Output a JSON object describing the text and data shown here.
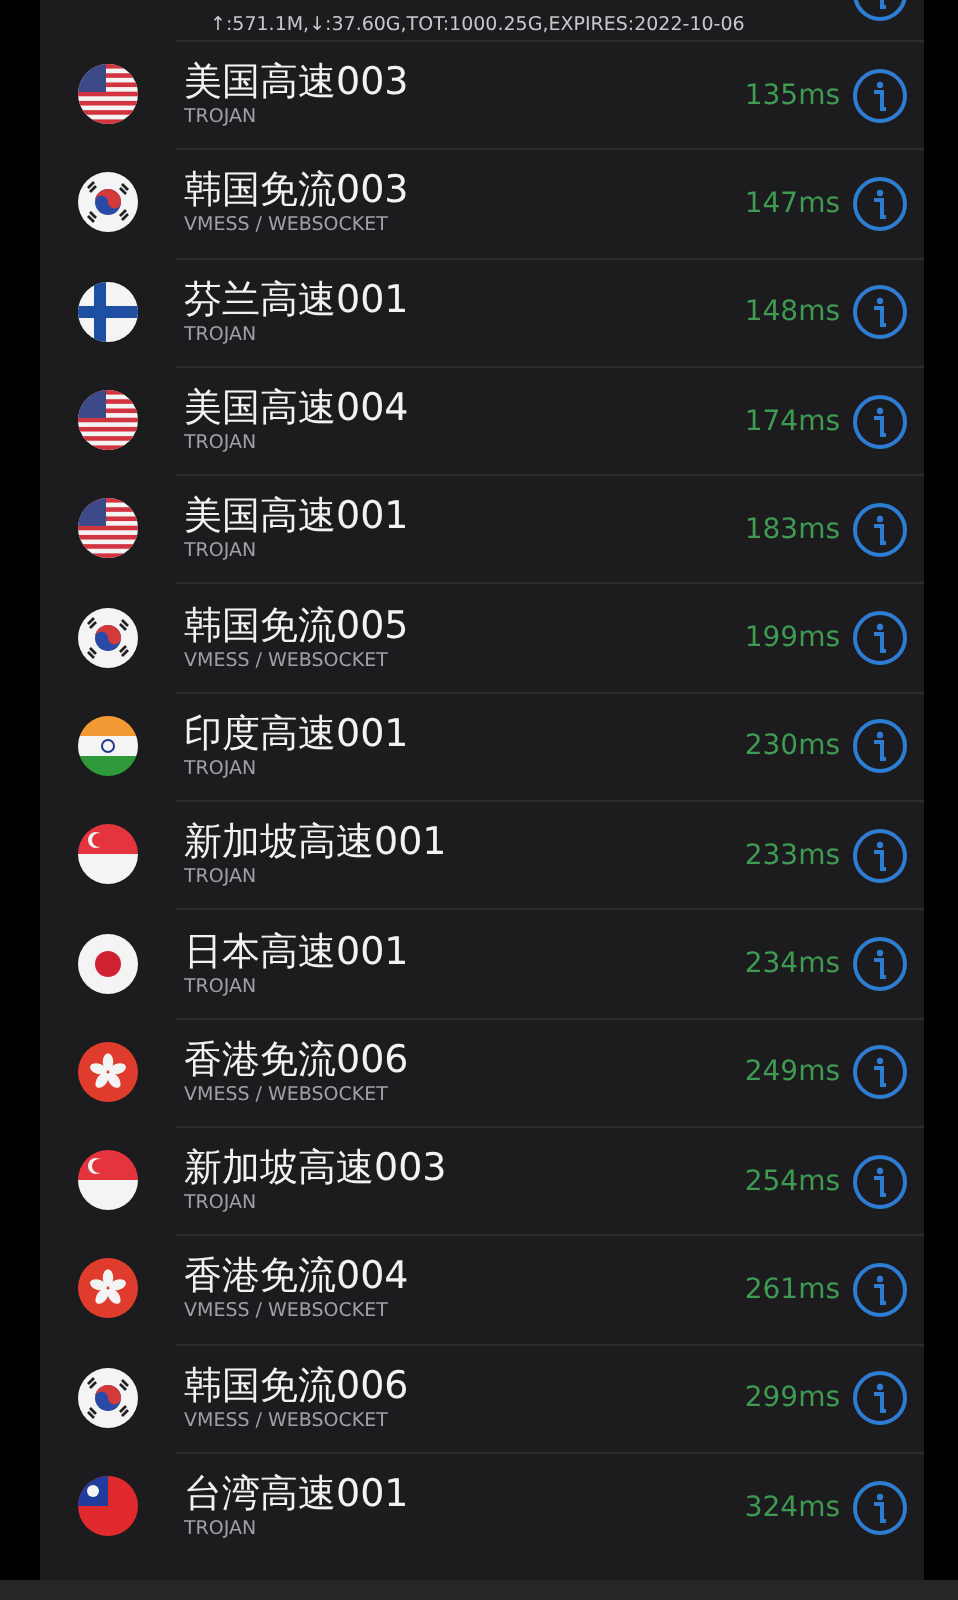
{
  "stats": "↑:571.1M,↓:37.60G,TOT:1000.25G,EXPIRES:2022-10-06",
  "servers": [
    {
      "kind": "us",
      "name": "美国高速003",
      "protocol": "TROJAN",
      "latency": "135ms"
    },
    {
      "kind": "kr",
      "name": "韩国免流003",
      "protocol": "VMESS / WEBSOCKET",
      "latency": "147ms"
    },
    {
      "kind": "fi",
      "name": "芬兰高速001",
      "protocol": "TROJAN",
      "latency": "148ms"
    },
    {
      "kind": "us",
      "name": "美国高速004",
      "protocol": "TROJAN",
      "latency": "174ms"
    },
    {
      "kind": "us",
      "name": "美国高速001",
      "protocol": "TROJAN",
      "latency": "183ms"
    },
    {
      "kind": "kr",
      "name": "韩国免流005",
      "protocol": "VMESS / WEBSOCKET",
      "latency": "199ms"
    },
    {
      "kind": "in",
      "name": "印度高速001",
      "protocol": "TROJAN",
      "latency": "230ms"
    },
    {
      "kind": "sg",
      "name": "新加坡高速001",
      "protocol": "TROJAN",
      "latency": "233ms"
    },
    {
      "kind": "jp",
      "name": "日本高速001",
      "protocol": "TROJAN",
      "latency": "234ms"
    },
    {
      "kind": "hk",
      "name": "香港免流006",
      "protocol": "VMESS / WEBSOCKET",
      "latency": "249ms"
    },
    {
      "kind": "sg",
      "name": "新加坡高速003",
      "protocol": "TROJAN",
      "latency": "254ms"
    },
    {
      "kind": "hk",
      "name": "香港免流004",
      "protocol": "VMESS / WEBSOCKET",
      "latency": "261ms"
    },
    {
      "kind": "kr",
      "name": "韩国免流006",
      "protocol": "VMESS / WEBSOCKET",
      "latency": "299ms"
    },
    {
      "kind": "tw",
      "name": "台湾高速001",
      "protocol": "TROJAN",
      "latency": "324ms"
    }
  ]
}
